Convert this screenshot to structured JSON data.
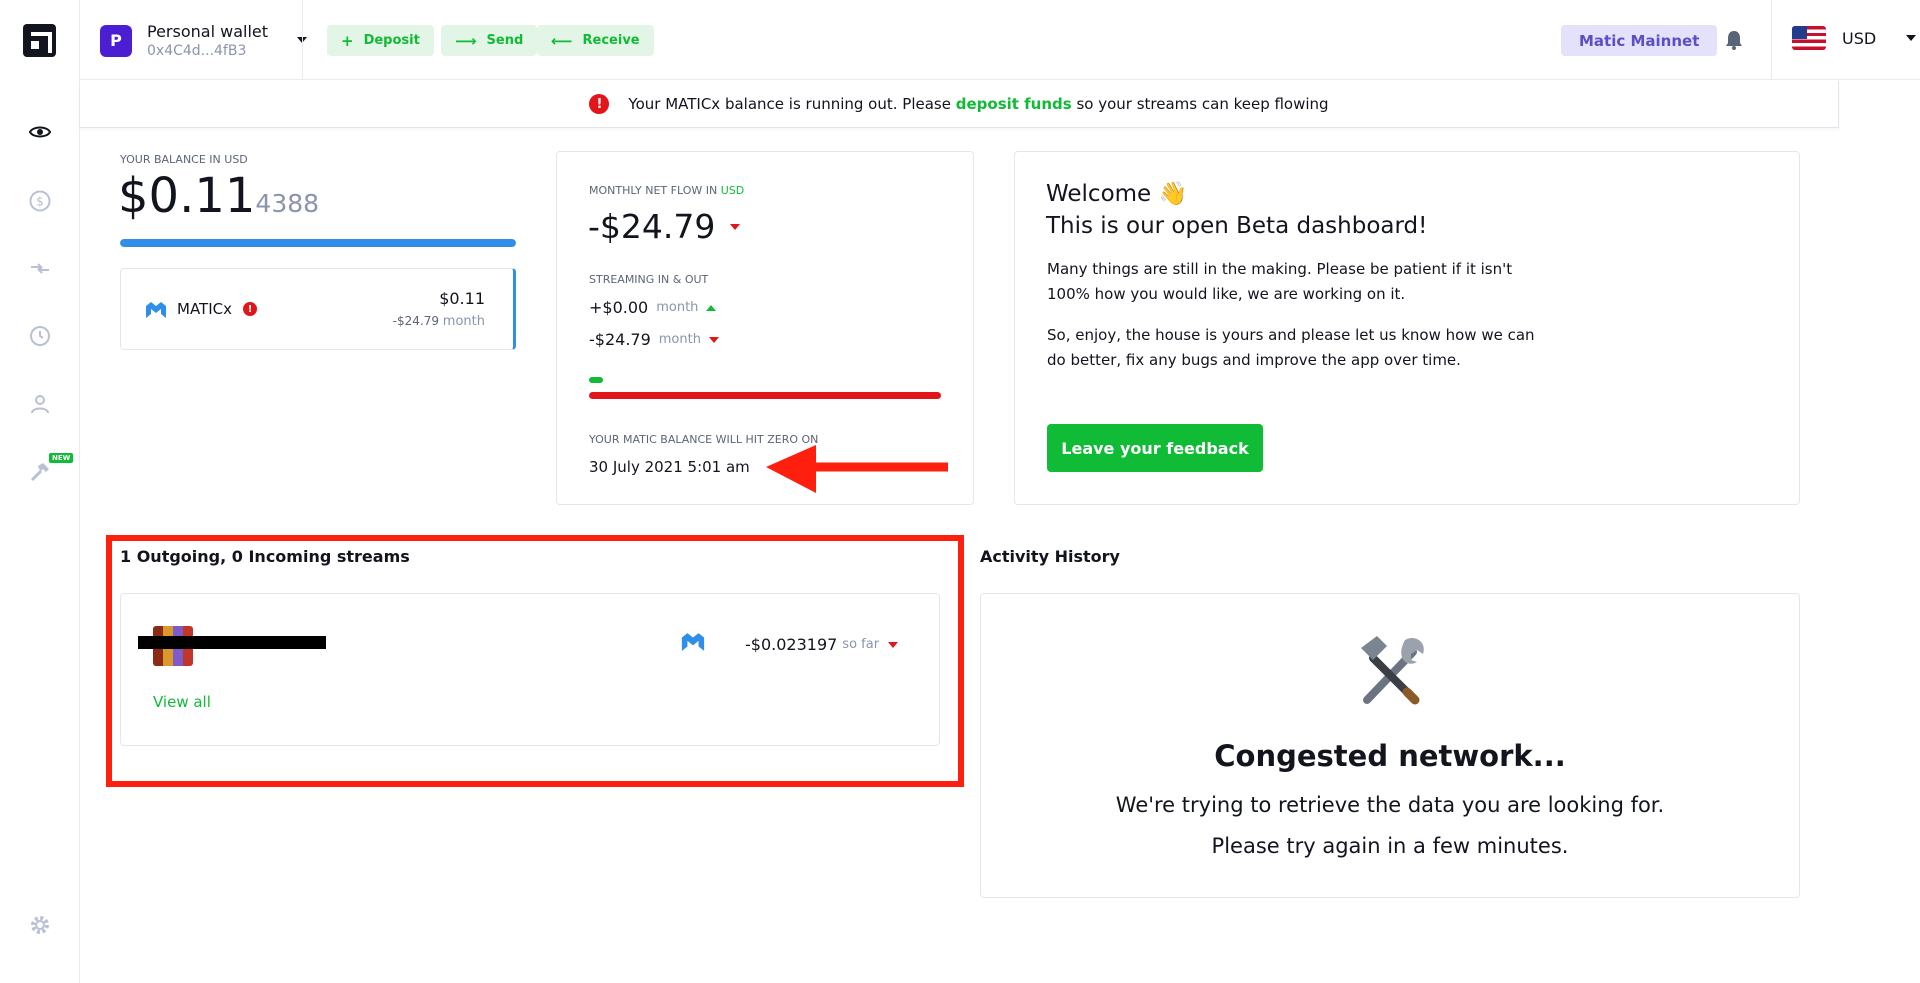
{
  "topbar": {
    "wallet_initial": "P",
    "wallet_name": "Personal wallet",
    "wallet_address": "0x4C4d...4fB3",
    "deposit_label": "Deposit",
    "send_label": "Send",
    "receive_label": "Receive",
    "network_label": "Matic Mainnet",
    "currency_label": "USD"
  },
  "sidebar": {
    "items": [
      {
        "icon": "eye-icon"
      },
      {
        "icon": "dollar-icon"
      },
      {
        "icon": "swap-icon"
      },
      {
        "icon": "history-icon"
      },
      {
        "icon": "user-icon"
      },
      {
        "icon": "hammer-icon",
        "badge": "NEW"
      },
      {
        "icon": "gear-icon"
      }
    ]
  },
  "alert": {
    "before": "Your MATICx balance is running out. Please ",
    "link": "deposit funds",
    "after": " so your streams can keep flowing"
  },
  "balance": {
    "label": "YOUR BALANCE IN USD",
    "main": "$0.11",
    "decimals": "4388",
    "bar_fraction": 1.0
  },
  "token": {
    "name": "MATICx",
    "warning": "!",
    "amount": "$0.11",
    "flow": "-$24.79",
    "flow_unit": "month"
  },
  "net_flow": {
    "label": "MONTHLY NET FLOW IN ",
    "label_currency": "USD",
    "value": "-$24.79",
    "streaming_label": "STREAMING IN & OUT",
    "in_value": "+$0.00",
    "in_unit": "month",
    "out_value": "-$24.79",
    "out_unit": "month",
    "zero_label": "YOUR MATIC BALANCE WILL HIT ZERO ON",
    "zero_date": "30 July 2021 5:01 am"
  },
  "welcome": {
    "title_line1": "Welcome 👋",
    "title_line2": "This is our open Beta dashboard!",
    "para1": "Many things are still in the making. Please be patient if it isn't 100% how you would like, we are working on it.",
    "para2": "So, enjoy, the house is yours and please let us know how we can do better, fix any bugs and improve the app over time.",
    "button": "Leave your feedback"
  },
  "streams": {
    "title": "1 Outgoing, 0 Incoming streams",
    "amount": "-$0.023197",
    "amount_unit": "so far",
    "view_all": "View all"
  },
  "activity": {
    "title": "Activity History",
    "heading": "Congested network...",
    "line1": "We're trying to retrieve the data you are looking for.",
    "line2": "Please try again in a few minutes."
  },
  "colors": {
    "accent_green": "#10bb35",
    "danger_red": "#e2151b",
    "balance_blue": "#2f8fe8",
    "network_purple": "#5a4fc4",
    "annotation_red": "#ff1f0f"
  }
}
